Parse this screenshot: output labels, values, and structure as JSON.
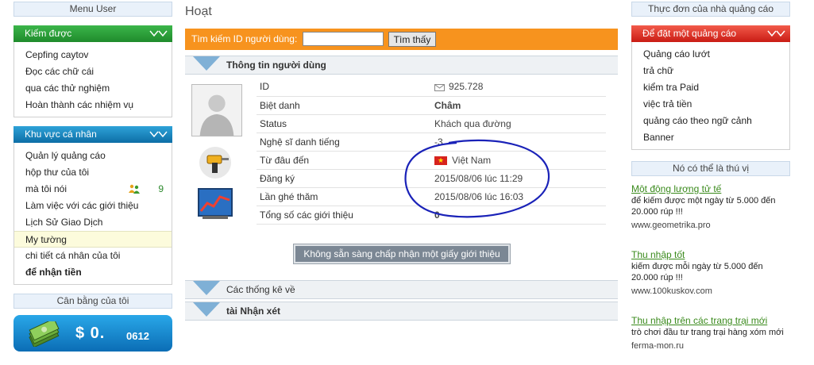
{
  "left": {
    "menu_user_title": "Menu User",
    "earn": {
      "title": "Kiếm được",
      "items": [
        "Cepfing caytov",
        "Đọc các chữ cái",
        "qua các thử nghiệm",
        "Hoàn thành các nhiệm vụ"
      ]
    },
    "personal": {
      "title": "Khu vực cá nhân",
      "items": [
        {
          "label": "Quản lý quảng cáo"
        },
        {
          "label": "hộp thư của tôi"
        },
        {
          "label": "mà tôi nói",
          "count": "9"
        },
        {
          "label": "Làm việc với các giới thiệu"
        },
        {
          "label": "Lịch Sử Giao Dịch"
        },
        {
          "label": "My tường"
        },
        {
          "label": "chi tiết cá nhân của tôi"
        },
        {
          "label": "để nhận tiền"
        }
      ]
    },
    "balance": {
      "title": "Cân bằng của tôi",
      "main": "$ 0.",
      "cents": "0612"
    }
  },
  "center": {
    "page_title": "Hoạt",
    "search": {
      "label": "Tìm kiếm ID người dùng:",
      "value": "",
      "button": "Tìm thấy"
    },
    "user_info_title": "Thông tin người dùng",
    "rows": [
      {
        "label": "ID",
        "value": "925.728"
      },
      {
        "label": "Biệt danh",
        "value": "Châm"
      },
      {
        "label": "Status",
        "value": "Khách qua đường"
      },
      {
        "label": "Nghệ sĩ danh tiếng",
        "value": "-3"
      },
      {
        "label": "Từ đâu đến",
        "value": "Việt Nam"
      },
      {
        "label": "Đăng ký",
        "value": "2015/08/06 lúc 11:29"
      },
      {
        "label": "Lần ghé thăm",
        "value": "2015/08/06 lúc 16:03"
      },
      {
        "label": "Tổng số các giới thiệu",
        "value": "0"
      }
    ],
    "invite_button": "Không sẵn sàng chấp nhận một giấy giới thiệu",
    "stats_title": "Các thống kê về",
    "comments_title": "tài Nhận xét"
  },
  "right": {
    "advertiser_title": "Thực đơn của nhà quảng cáo",
    "order": {
      "title": "Để đặt một quảng cáo",
      "items": [
        "Quảng cáo lướt",
        "trả chữ",
        "kiểm tra Paid",
        "việc trả tiền",
        "quảng cáo theo ngữ cảnh",
        "Banner"
      ]
    },
    "interest_title": "Nó có thể là thú vị",
    "promos": [
      {
        "title": "Một động lượng tử tế",
        "desc": "để kiếm được một ngày từ 5.000 đến 20.000 rúp !!!",
        "url": "www.geometrika.pro"
      },
      {
        "title": "Thu nhập tốt",
        "desc": "kiếm được mỗi ngày từ 5.000 đến 20.000 rúp !!!",
        "url": "www.100kuskov.com"
      },
      {
        "title": "Thu nhập trên các trang trại mới",
        "desc": "trò chơi đầu tư trang trại hàng xóm mới",
        "url": "ferma-mon.ru"
      }
    ]
  },
  "colors": {
    "green_header": "#2aa03a",
    "blue_header": "#1a86c2",
    "red_header": "#e0342a",
    "search_bar": "#f7931e",
    "promo_link": "#3a8a1c"
  }
}
